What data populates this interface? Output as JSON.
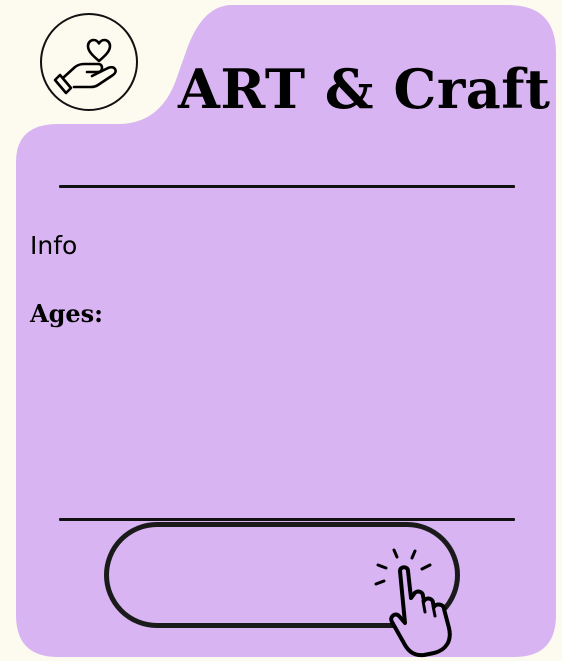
{
  "card": {
    "title": "ART & Craft",
    "info_text": "Info",
    "ages_label": "Ages:"
  },
  "colors": {
    "page_background": "#fdfbef",
    "card_background": "#d8b4f2",
    "ink": "#111111"
  },
  "icons": {
    "logo": "hand-holding-heart-icon",
    "button": "pointing-hand-icon"
  }
}
